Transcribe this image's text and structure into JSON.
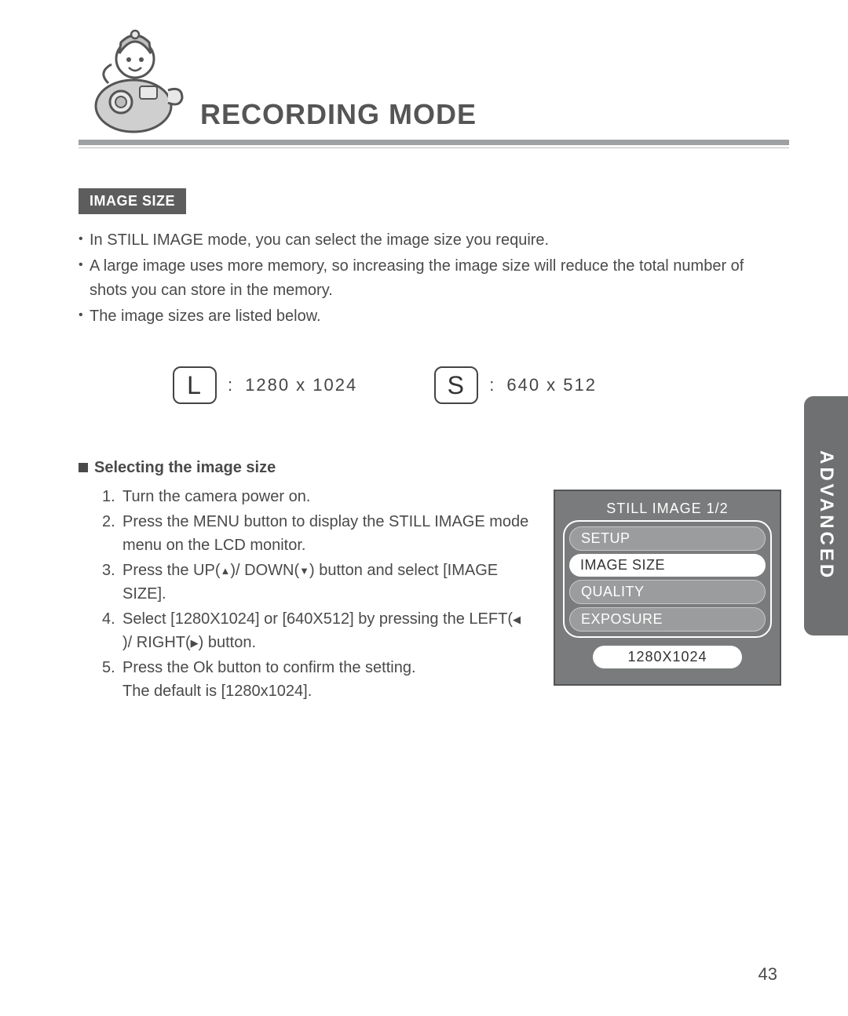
{
  "header": {
    "title": "RECORDING MODE"
  },
  "section": {
    "label": "IMAGE SIZE"
  },
  "bullets": [
    "In STILL IMAGE mode, you can select the image size you require.",
    "A large image uses more memory, so increasing the image size will reduce the total number of shots you can store in the memory.",
    "The image sizes are listed below."
  ],
  "sizes": {
    "large_letter": "L",
    "large_value": "1280  x  1024",
    "small_letter": "S",
    "small_value": "640  x  512",
    "colon": ":"
  },
  "subheading": "Selecting the image size",
  "steps": {
    "s1": "Turn the camera power on.",
    "s2": "Press the MENU button to display the STILL IMAGE mode menu on the LCD monitor.",
    "s3a": "Press the UP(",
    "s3b": ")/ DOWN(",
    "s3c": ") button and select [IMAGE SIZE].",
    "s4a": "Select [1280X1024] or [640X512] by pressing the LEFT(",
    "s4b": ")/ RIGHT(",
    "s4c": ") button.",
    "s5a": "Press the Ok button to confirm the setting.",
    "s5b": "The default is [1280x1024]."
  },
  "lcd": {
    "title": "STILL IMAGE 1/2",
    "items": [
      "SETUP",
      "IMAGE SIZE",
      "QUALITY",
      "EXPOSURE"
    ],
    "selected_index": 1,
    "value": "1280X1024"
  },
  "side_tab": "ADVANCED",
  "page_number": "43"
}
